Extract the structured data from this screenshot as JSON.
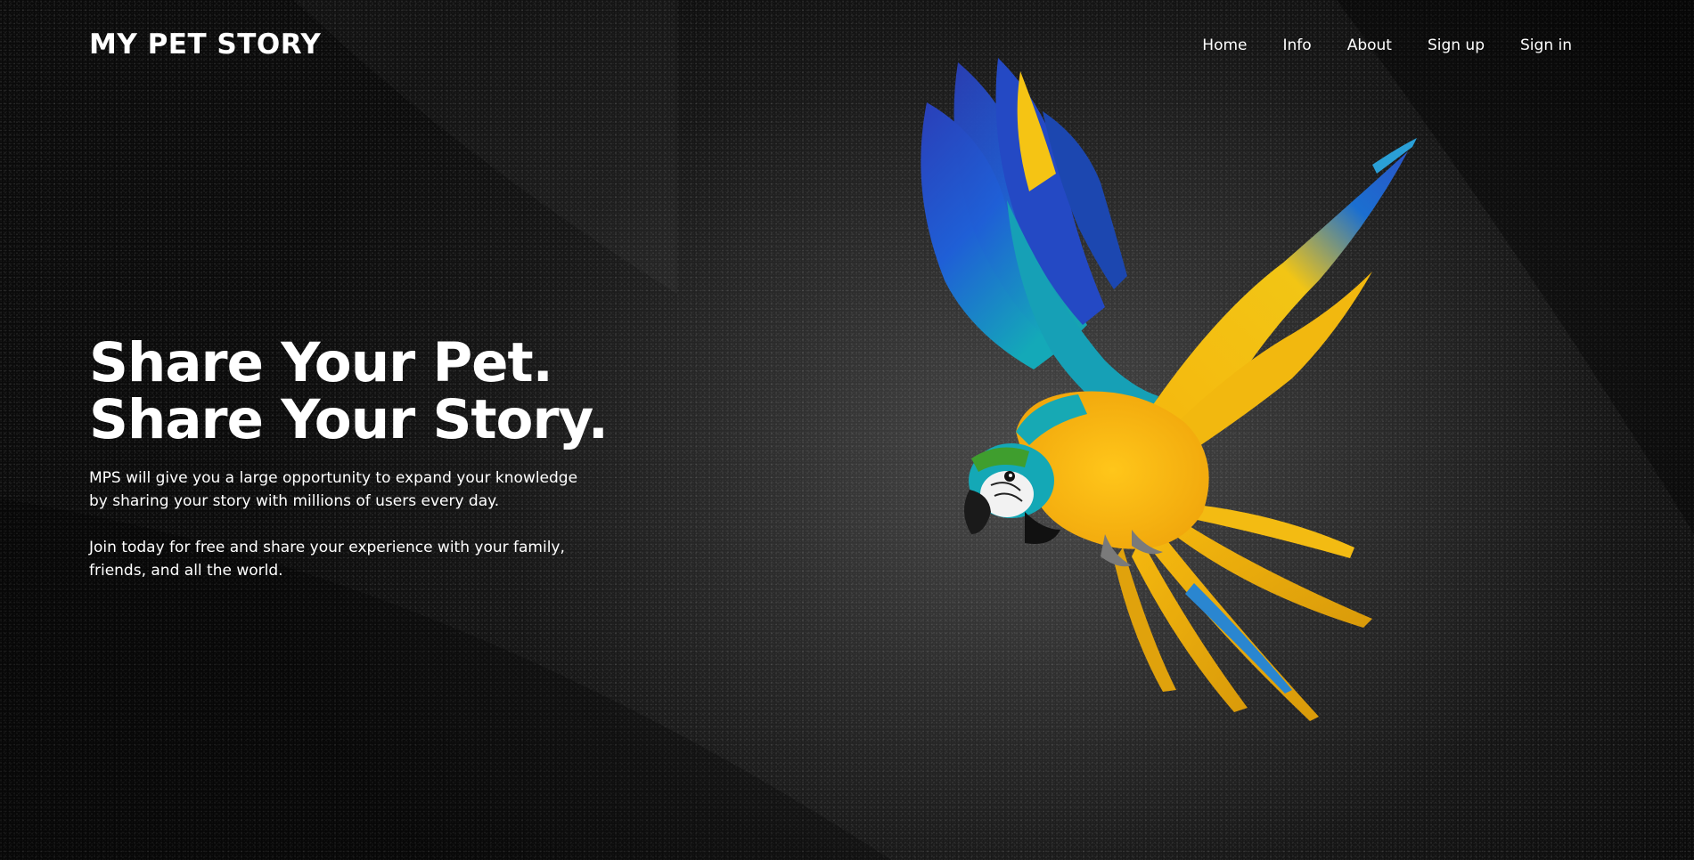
{
  "header": {
    "logo": "MY PET STORY",
    "nav": [
      "Home",
      "Info",
      "About",
      "Sign up",
      "Sign in"
    ]
  },
  "hero": {
    "title_line1": "Share Your Pet.",
    "title_line2": "Share Your Story.",
    "paragraph1": "MPS will give you a large opportunity to expand your knowledge by sharing your story with millions of users every day.",
    "paragraph2": "Join today for free and share your experience with your family, friends, and all the world."
  },
  "colors": {
    "background": "#0b0b0b",
    "text": "#ffffff",
    "parrot_blue": "#1f5fd6",
    "parrot_teal": "#14a9b8",
    "parrot_yellow": "#f5b80e"
  },
  "image": {
    "hero_subject": "parrot-illustration"
  }
}
